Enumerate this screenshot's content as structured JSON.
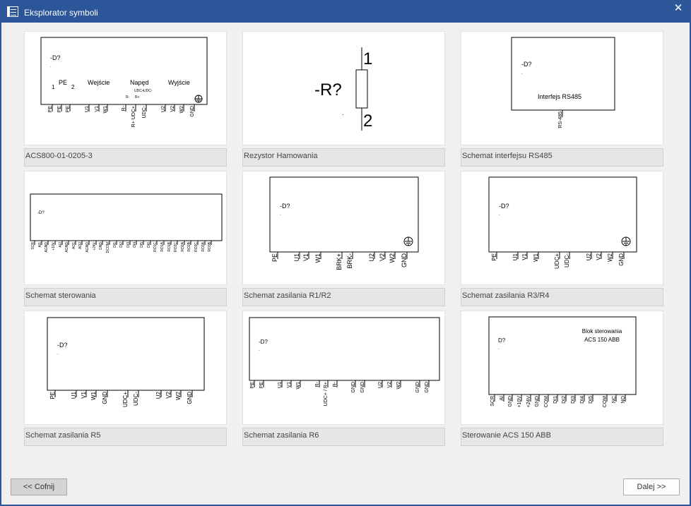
{
  "window": {
    "title": "Eksplorator symboli",
    "close_glyph": "✕"
  },
  "symbols": [
    {
      "caption": "ACS800-01-0205-3",
      "tag": "-D?",
      "num1": "1",
      "pe": "PE",
      "num2": "2",
      "sections": [
        "Wejście",
        "Napęd",
        "Wyjście"
      ],
      "small_r": [
        "R-",
        "R+"
      ],
      "small_udc": [
        "UDC+",
        "UDC-"
      ],
      "pins": [
        "PE",
        "PE",
        "PE",
        "U1",
        "V1",
        "W1",
        "R-",
        "R+ UDC+",
        "UDC-",
        "U2",
        "V2",
        "W2",
        "GND"
      ]
    },
    {
      "caption": "Rezystor Hamowania",
      "tag": "-R?",
      "pin_top": "1",
      "pin_bottom": "2"
    },
    {
      "caption": "Schemat interfejsu RS485",
      "tag": "-D?",
      "label": "Interfejs RS485",
      "pins": [
        "RS-485"
      ]
    },
    {
      "caption": "Schemat sterowania",
      "tag": "-D?",
      "pins": [
        "SCR",
        "AI1",
        "AGND",
        "+10V",
        "AI2",
        "AGND",
        "AO1",
        "AO2",
        "AGND",
        "+24V",
        "GND",
        "DCOM",
        "DI1",
        "DI2",
        "DI3",
        "DI4",
        "DI5",
        "DI6",
        "RO1C",
        "RO1A",
        "RO1B",
        "RO2C",
        "RO2A",
        "RO2B",
        "RO3C",
        "RO3A",
        "RO3B"
      ]
    },
    {
      "caption": "Schemat zasilania R1/R2",
      "tag": "-D?",
      "pins": [
        "PE",
        "U1",
        "V1",
        "W1",
        "BRK+",
        "BRK-",
        "U2",
        "V2",
        "W2",
        "GND"
      ]
    },
    {
      "caption": "Schemat zasilania R3/R4",
      "tag": "-D?",
      "pins": [
        "PE",
        "U1",
        "V1",
        "W1",
        "UDC+",
        "UDC-",
        "U2",
        "V2",
        "W2",
        "GND"
      ]
    },
    {
      "caption": "Schemat zasilania R5",
      "tag": "-D?",
      "pins": [
        "PE",
        "U1",
        "V1",
        "W1",
        "GND",
        "UDC+",
        "UDC-",
        "U2",
        "V2",
        "W2",
        "GND"
      ]
    },
    {
      "caption": "Schemat zasilania R6",
      "tag": "-D?",
      "pins": [
        "PE",
        "PE",
        "U1",
        "V1",
        "W1",
        "R-",
        "UDC+ / R+",
        "R-",
        "GND",
        "GND",
        "U2",
        "V2",
        "W2",
        "GND",
        "GND"
      ]
    },
    {
      "caption": "Sterowanie ACS 150 ABB",
      "tag": "D?",
      "label_lines": [
        "Blok sterowania",
        "ACS 150 ABB"
      ],
      "pins": [
        "SCR",
        "AI",
        "GND",
        "+10V",
        "+24V",
        "GND",
        "COM",
        "DI1",
        "DI2",
        "DI3",
        "DI4",
        "DI5",
        "COM",
        "NC",
        "NO"
      ]
    }
  ],
  "footer": {
    "back_label": "<< Cofnij",
    "next_label": "Dalej >>"
  }
}
